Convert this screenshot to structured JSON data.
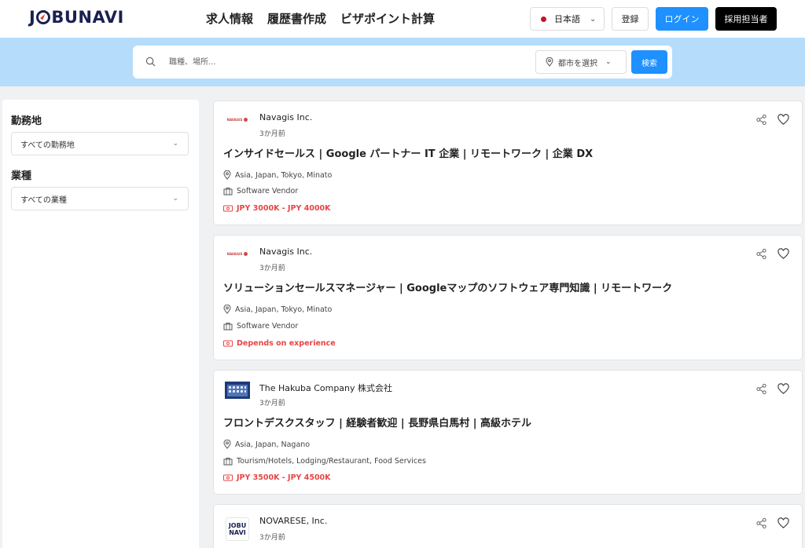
{
  "header": {
    "logo_left": "J",
    "logo_right": "BUNAVI",
    "nav": [
      "求人情報",
      "履歴書作成",
      "ビザポイント計算"
    ],
    "language": "日本語",
    "register_label": "登録",
    "login_label": "ログイン",
    "recruiter_label": "採用担当者"
  },
  "search": {
    "placeholder": "職種、場所...",
    "city_label": "都市を選択",
    "button_label": "検索"
  },
  "sidebar": {
    "location_label": "勤務地",
    "location_value": "すべての勤務地",
    "industry_label": "業種",
    "industry_value": "すべての業種"
  },
  "jobs": [
    {
      "company": "Navagis Inc.",
      "logo_text": "NAVAGIS",
      "posted": "3か月前",
      "title": "インサイドセールス | Google パートナー IT 企業 | リモートワーク | 企業 DX",
      "location": "Asia, Japan, Tokyo, Minato",
      "industry": "Software Vendor",
      "salary": "JPY 3000K - JPY 4000K"
    },
    {
      "company": "Navagis Inc.",
      "logo_text": "NAVAGIS",
      "posted": "3か月前",
      "title": "ソリューションセールスマネージャー | Googleマップのソフトウェア専門知識 | リモートワーク",
      "location": "Asia, Japan, Tokyo, Minato",
      "industry": "Software Vendor",
      "salary": "Depends on experience"
    },
    {
      "company": "The Hakuba Company 株式会社",
      "posted": "3か月前",
      "title": "フロントデスクスタッフ | 経験者歓迎 | 長野県白馬村 | 高級ホテル",
      "location": "Asia, Japan, Nagano",
      "industry": "Tourism/Hotels, Lodging/Restaurant, Food Services",
      "salary": "JPY 3500K - JPY 4500K"
    },
    {
      "company": "NOVARESE, Inc.",
      "logo_text_top": "JOBU",
      "logo_text_bottom": "NAVI",
      "posted": "3か月前"
    }
  ],
  "colors": {
    "primary": "#1e90ff",
    "band": "#b5dcfb",
    "salary": "#e84545",
    "logo": "#1a2150"
  }
}
